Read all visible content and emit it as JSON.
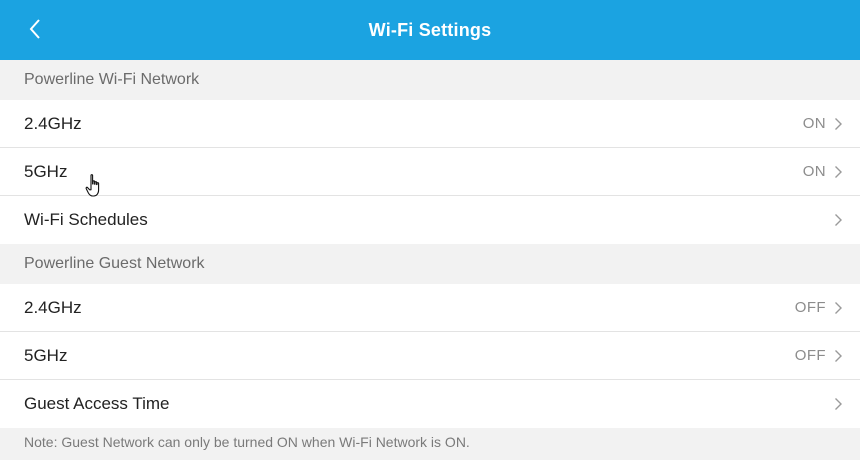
{
  "header": {
    "title": "Wi-Fi Settings",
    "background_color": "#1ba3e1"
  },
  "sections": [
    {
      "title": "Powerline Wi-Fi Network",
      "rows": [
        {
          "label": "2.4GHz",
          "value": "ON"
        },
        {
          "label": "5GHz",
          "value": "ON"
        },
        {
          "label": "Wi-Fi Schedules",
          "value": ""
        }
      ]
    },
    {
      "title": "Powerline Guest Network",
      "rows": [
        {
          "label": "2.4GHz",
          "value": "OFF"
        },
        {
          "label": "5GHz",
          "value": "OFF"
        },
        {
          "label": "Guest Access Time",
          "value": ""
        }
      ]
    }
  ],
  "note": "Note: Guest Network can only be turned ON when Wi-Fi Network is ON.",
  "icons": {
    "back": "chevron-left-icon",
    "row_arrow": "chevron-right-icon",
    "cursor": "hand-pointer-icon"
  }
}
